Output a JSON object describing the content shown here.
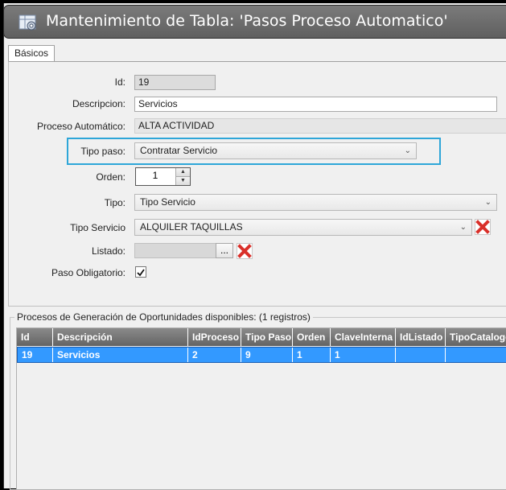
{
  "window": {
    "title": "Mantenimiento de Tabla: 'Pasos Proceso Automatico'",
    "app_icon": "gear-table-icon"
  },
  "tabs": [
    {
      "label": "Básicos",
      "active": true
    }
  ],
  "form": {
    "id": {
      "label": "Id:",
      "value": "19"
    },
    "descripcion": {
      "label": "Descripcion:",
      "value": "Servicios"
    },
    "proceso": {
      "label": "Proceso Automático:",
      "value": "ALTA ACTIVIDAD"
    },
    "tipo_paso": {
      "label": "Tipo paso:",
      "value": "Contratar Servicio"
    },
    "orden": {
      "label": "Orden:",
      "value": "1"
    },
    "tipo": {
      "label": "Tipo:",
      "value": "Tipo Servicio"
    },
    "tipo_servicio": {
      "label": "Tipo Servicio",
      "value": "ALQUILER TAQUILLAS"
    },
    "listado": {
      "label": "Listado:",
      "value": "",
      "browse_label": "..."
    },
    "paso_obligatorio": {
      "label": "Paso Obligatorio:",
      "checked": true
    }
  },
  "group": {
    "legend": "Procesos de Generación de Oportunidades disponibles:  (1 registros)"
  },
  "grid": {
    "columns": [
      "Id",
      "Descripción",
      "IdProceso",
      "Tipo Paso",
      "Orden",
      "ClaveInterna",
      "IdListado",
      "TipoCatalogo"
    ],
    "rows": [
      [
        "19",
        "Servicios",
        "2",
        "9",
        "1",
        "1",
        "",
        ""
      ]
    ]
  },
  "colors": {
    "highlight": "#2ea6d8",
    "selection": "#3399ff",
    "delete": "#d9302a"
  }
}
